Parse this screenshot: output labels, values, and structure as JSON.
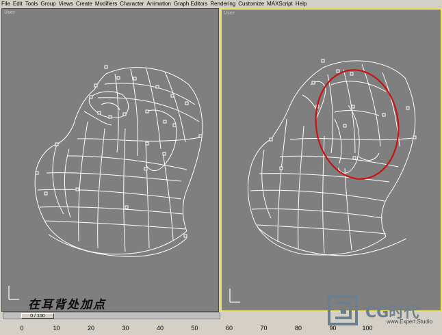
{
  "menu": [
    "File",
    "Edit",
    "Tools",
    "Group",
    "Views",
    "Create",
    "Modifiers",
    "Character",
    "Animation",
    "Graph Editors",
    "Rendering",
    "Customize",
    "MAXScript",
    "Help"
  ],
  "viewports": {
    "left": {
      "label": "User",
      "caption": "在耳背处加点"
    },
    "right": {
      "label": "User"
    }
  },
  "timeline": {
    "frame_display": "0 / 100"
  },
  "ruler_ticks": [
    "0",
    "10",
    "20",
    "30",
    "40",
    "50",
    "60",
    "70",
    "80",
    "90",
    "100"
  ],
  "logo": {
    "text": "CG时代"
  },
  "watermark_text": "www.Expert.Studio",
  "colors": {
    "viewport_bg": "#7f7f7f",
    "wire": "#ffffff",
    "highlight_ellipse": "#cc1010",
    "active_border": "#f0e060"
  }
}
